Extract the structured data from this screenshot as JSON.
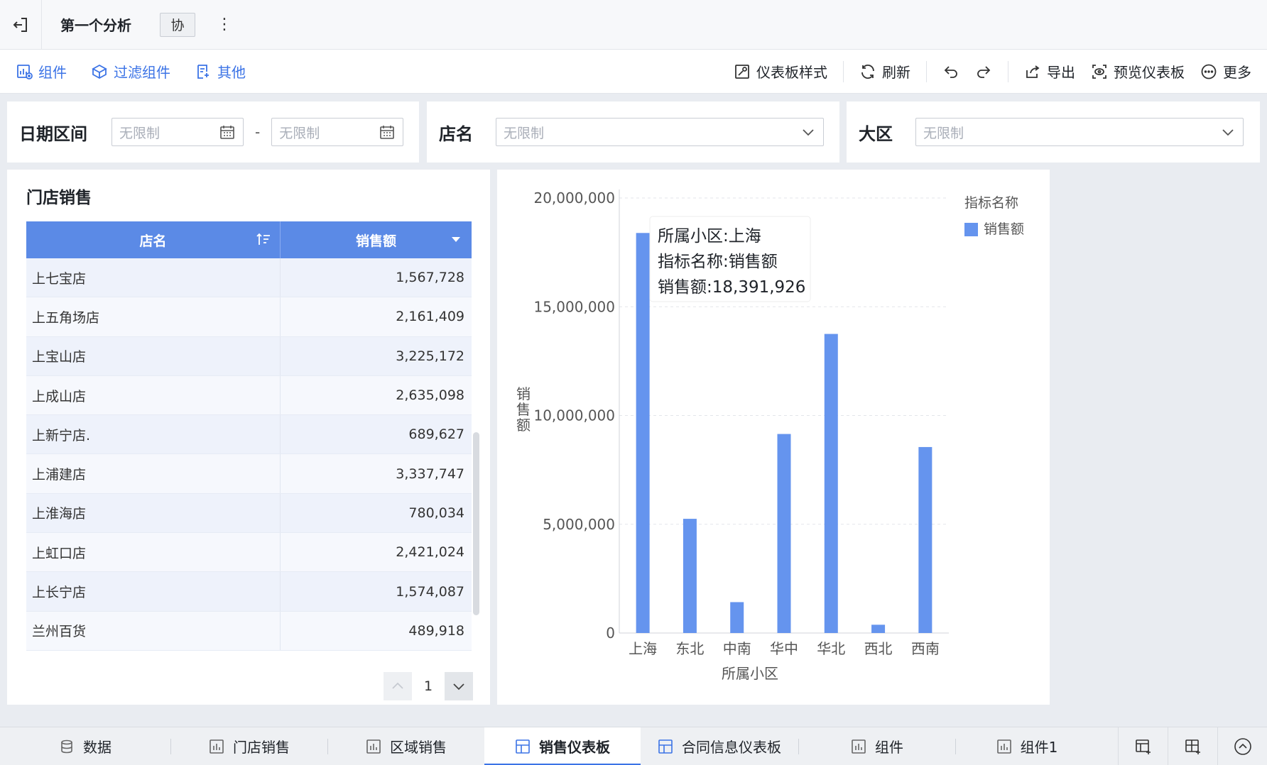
{
  "window": {
    "title": "第一个分析",
    "co_badge": "协"
  },
  "toolbar": {
    "left": [
      {
        "label": "组件",
        "icon": "add-chart-icon"
      },
      {
        "label": "过滤组件",
        "icon": "filter-widget-icon"
      },
      {
        "label": "其他",
        "icon": "other-icon"
      }
    ],
    "dashboard_style": "仪表板样式",
    "refresh": "刷新",
    "export": "导出",
    "preview": "预览仪表板",
    "more": "更多"
  },
  "filters": {
    "date": {
      "label": "日期区间",
      "start_placeholder": "无限制",
      "end_placeholder": "无限制",
      "separator": "-"
    },
    "store": {
      "label": "店名",
      "placeholder": "无限制"
    },
    "region": {
      "label": "大区",
      "placeholder": "无限制"
    }
  },
  "table": {
    "title": "门店销售",
    "columns": [
      "店名",
      "销售额"
    ],
    "rows": [
      [
        "上七宝店",
        "1,567,728"
      ],
      [
        "上五角场店",
        "2,161,409"
      ],
      [
        "上宝山店",
        "3,225,172"
      ],
      [
        "上成山店",
        "2,635,098"
      ],
      [
        "上新宁店.",
        "689,627"
      ],
      [
        "上浦建店",
        "3,337,747"
      ],
      [
        "上淮海店",
        "780,034"
      ],
      [
        "上虹口店",
        "2,421,024"
      ],
      [
        "上长宁店",
        "1,574,087"
      ],
      [
        "兰州百货",
        "489,918"
      ]
    ],
    "page": "1"
  },
  "chart_data": {
    "type": "bar",
    "categories": [
      "上海",
      "东北",
      "中南",
      "华中",
      "华北",
      "西北",
      "西南"
    ],
    "series": [
      {
        "name": "销售额",
        "values": [
          18391926,
          5250000,
          1420000,
          9150000,
          13750000,
          380000,
          8550000
        ]
      }
    ],
    "ylim": [
      0,
      20000000
    ],
    "yticks": [
      0,
      5000000,
      10000000,
      15000000,
      20000000
    ],
    "ytick_labels": [
      "0",
      "5,000,000",
      "10,000,000",
      "15,000,000",
      "20,000,000"
    ],
    "xlabel": "所属小区",
    "ylabel": "销售额",
    "legend_title": "指标名称",
    "legend_position": "top-right",
    "bar_color": "#6594ee",
    "tooltip": {
      "line1": "所属小区:上海",
      "line2": "指标名称:销售额",
      "line3": "销售额:18,391,926"
    }
  },
  "tabs": [
    {
      "label": "数据",
      "icon": "database-icon",
      "active": false
    },
    {
      "label": "门店销售",
      "icon": "bar-chart-icon",
      "active": false
    },
    {
      "label": "区域销售",
      "icon": "bar-chart-icon",
      "active": false
    },
    {
      "label": "销售仪表板",
      "icon": "dashboard-icon",
      "active": true
    },
    {
      "label": "合同信息仪表板",
      "icon": "dashboard-icon",
      "active": false
    },
    {
      "label": "组件",
      "icon": "bar-chart-icon",
      "active": false
    },
    {
      "label": "组件1",
      "icon": "bar-chart-icon",
      "active": false
    }
  ]
}
